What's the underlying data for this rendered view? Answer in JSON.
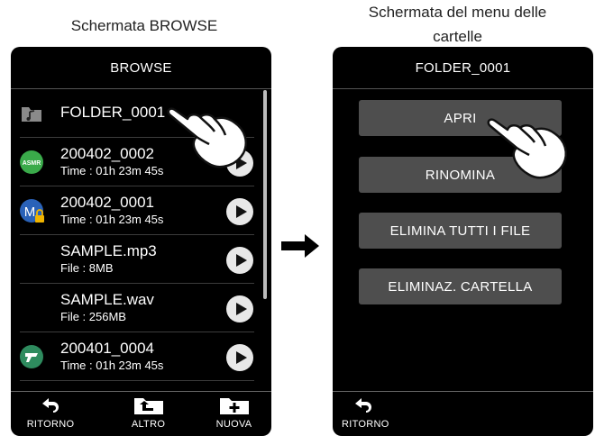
{
  "captions": {
    "left": "Schermata BROWSE",
    "right_line1": "Schermata del menu delle",
    "right_line2": "cartelle"
  },
  "browse": {
    "title": "BROWSE",
    "rows": [
      {
        "name": "FOLDER_0001",
        "sub": "",
        "icon": "folder-music-icon"
      },
      {
        "name": "200402_0002",
        "sub": "Time : 01h 23m 45s",
        "icon": "asmr-icon",
        "icon_text": "ASMR",
        "icon_color": "#3aaa4a"
      },
      {
        "name": "200402_0001",
        "sub": "Time : 01h 23m 45s",
        "icon": "m-lock-icon",
        "icon_text": "M",
        "icon_color": "#2a62b8"
      },
      {
        "name": "SAMPLE.mp3",
        "sub": "File : 8MB",
        "icon": ""
      },
      {
        "name": "SAMPLE.wav",
        "sub": "File : 256MB",
        "icon": ""
      },
      {
        "name": "200401_0004",
        "sub": "Time : 01h 23m 45s",
        "icon": "mic-icon",
        "icon_color": "#2e8b5e"
      }
    ],
    "toolbar": {
      "back": "RITORNO",
      "other": "ALTRO",
      "new": "NUOVA"
    }
  },
  "menu": {
    "title": "FOLDER_0001",
    "open": "APRI",
    "rename": "RINOMINA",
    "delete_all": "ELIMINA TUTTI I FILE",
    "delete_folder": "ELIMINAZ. CARTELLA",
    "back": "RITORNO"
  },
  "colors": {
    "screen_bg": "#000000",
    "button_bg": "#4e4e4e",
    "play_bg": "#e8e8e8"
  }
}
